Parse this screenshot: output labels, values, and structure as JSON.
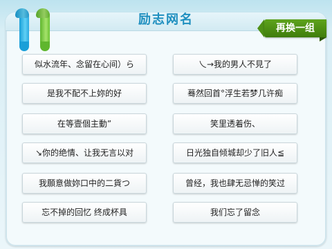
{
  "header": {
    "title": "励志网名",
    "refresh_label": "再换一组"
  },
  "names": [
    [
      "似水流年、念留在心间）ら",
      "乀→我的男人不見了"
    ],
    [
      "是我不配不上妳的好",
      "蓦然回首°浮生若梦几许痴"
    ],
    [
      "在等壹個主動”",
      "笑里透着伤、"
    ],
    [
      "↘你的绝情、让我无言以对",
      "日光独自倾城却少了旧人≦"
    ],
    [
      "我願意做妳口中的二貨つ",
      "曾经，我也肆无忌惮的笑过"
    ],
    [
      "忘不掉的回忆 终成杯具",
      "我们忘了留念"
    ]
  ],
  "colors": {
    "title": "#1f8fbf",
    "refresh_bg": "#4f9116",
    "ribbon_blue": "#1a9fd8",
    "ribbon_green": "#5fb62e"
  }
}
